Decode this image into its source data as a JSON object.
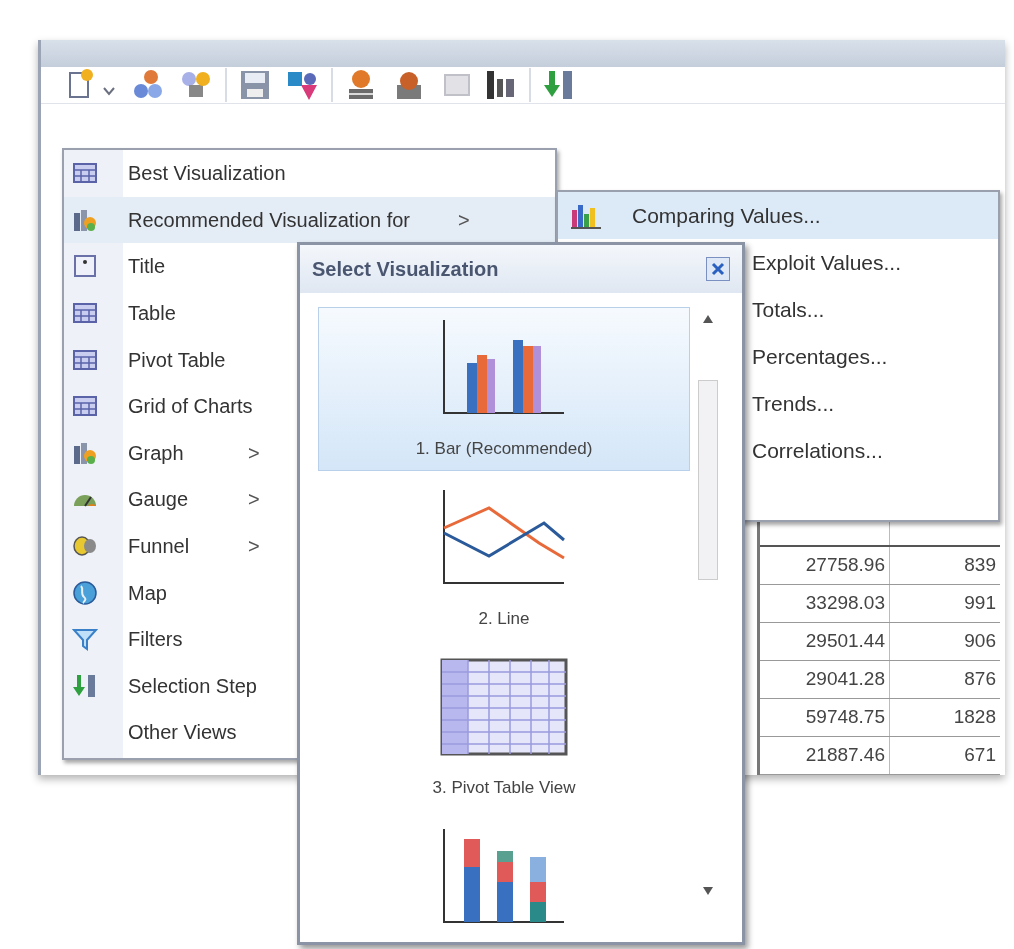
{
  "menu": {
    "items": [
      {
        "label": "Best Visualization",
        "kind": "table",
        "selected": false
      },
      {
        "label": "Recommended Visualization for",
        "kind": "graph",
        "selected": true,
        "submenu_arrow": ">"
      },
      {
        "label": "Title",
        "kind": "title",
        "selected": false
      },
      {
        "label": "Table",
        "kind": "table",
        "selected": false
      },
      {
        "label": "Pivot Table",
        "kind": "table",
        "selected": false
      },
      {
        "label": "Grid of Charts",
        "kind": "table",
        "selected": false
      },
      {
        "label": "Graph",
        "kind": "graph",
        "selected": false,
        "submenu_arrow": ">"
      },
      {
        "label": "Gauge",
        "kind": "gauge",
        "selected": false,
        "submenu_arrow": ">"
      },
      {
        "label": "Funnel",
        "kind": "funnel",
        "selected": false,
        "submenu_arrow": ">"
      },
      {
        "label": "Map",
        "kind": "map",
        "selected": false
      },
      {
        "label": "Filters",
        "kind": "filter",
        "selected": false
      },
      {
        "label": "Selection Step",
        "kind": "step",
        "selected": false
      },
      {
        "label": "Other Views",
        "kind": "none",
        "selected": false
      }
    ]
  },
  "submenu": {
    "items": [
      {
        "label": "Comparing Values...",
        "selected": true
      },
      {
        "label": "Exploit Values...",
        "selected": false
      },
      {
        "label": "Totals...",
        "selected": false
      },
      {
        "label": "Percentages...",
        "selected": false
      },
      {
        "label": "Trends...",
        "selected": false
      },
      {
        "label": "Correlations...",
        "selected": false
      }
    ]
  },
  "table": {
    "rows": [
      [
        "27758.96",
        "839"
      ],
      [
        "33298.03",
        "991"
      ],
      [
        "29501.44",
        "906"
      ],
      [
        "29041.28",
        "876"
      ],
      [
        "59748.75",
        "1828"
      ],
      [
        "21887.46",
        "671"
      ]
    ]
  },
  "dialog": {
    "title": "Select Visualization",
    "options": [
      {
        "label": "1. Bar (Recommended)",
        "kind": "bar",
        "selected": true
      },
      {
        "label": "2. Line",
        "kind": "line",
        "selected": false
      },
      {
        "label": "3. Pivot Table View",
        "kind": "pivot",
        "selected": false
      },
      {
        "kind": "stacked",
        "selected": false
      }
    ]
  }
}
